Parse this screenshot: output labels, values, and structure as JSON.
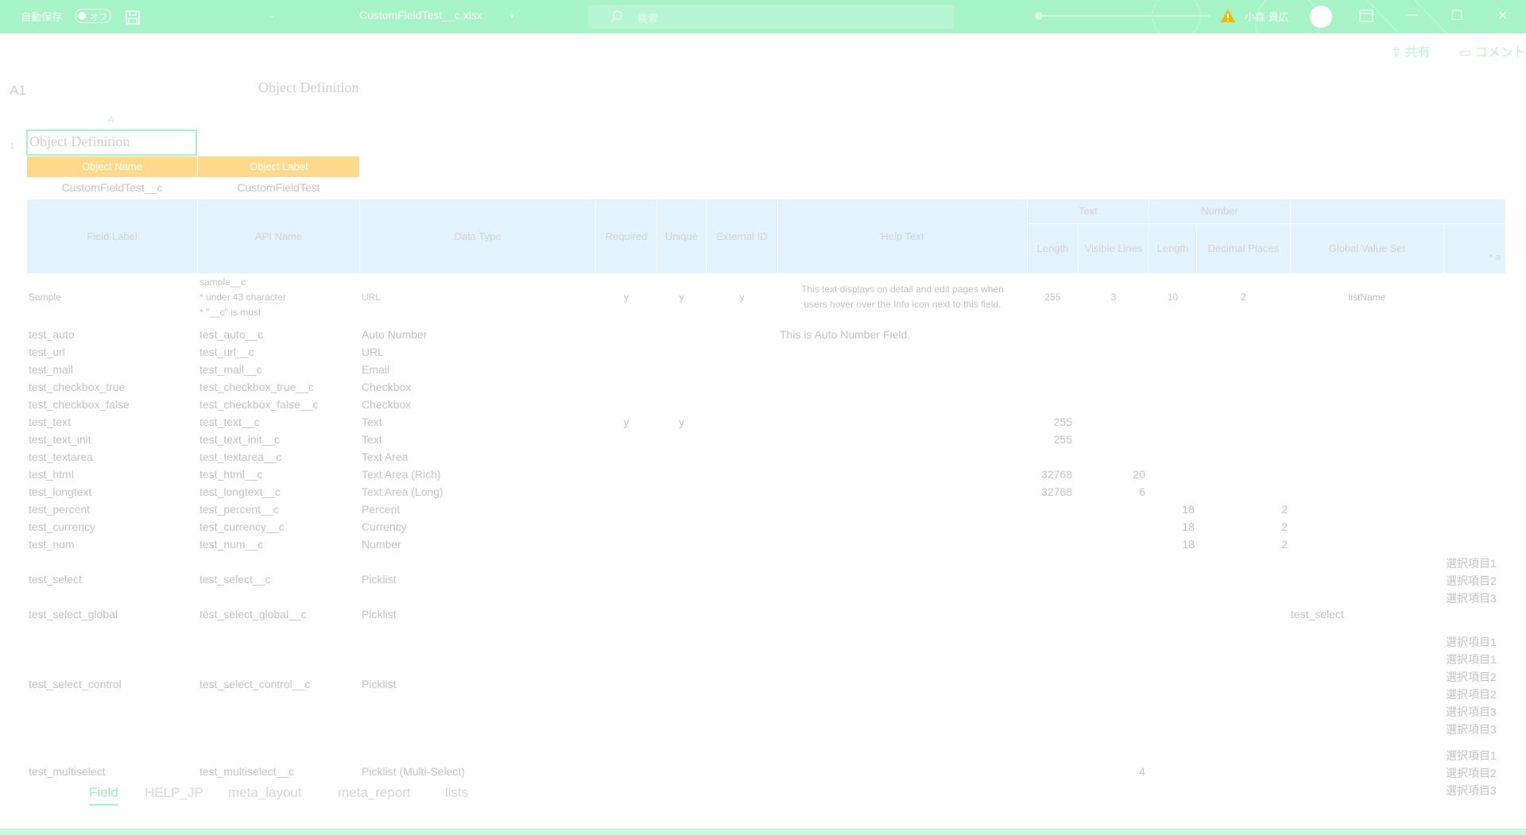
{
  "titlebar": {
    "autosave_label": "自動保存",
    "autosave_state": "オフ",
    "filename": "CustomFieldTest__c.xlsx",
    "search_placeholder": "検索",
    "user_name": "小森 貴広",
    "bg_color": "#a6f3c7"
  },
  "ribbon": {
    "share_label": "共有",
    "comment_label": "コメント"
  },
  "formula_bar": {
    "name_box": "A1",
    "formula": "Object Definition"
  },
  "sheet": {
    "column_letter": "A",
    "row_number": "1",
    "title": "Object Definition",
    "object_headers": [
      "Object Name",
      "Object Label"
    ],
    "object_values": [
      "CustomFieldTest__c",
      "CustomFieldTest"
    ],
    "headers": {
      "field_label": "Field Label",
      "api_name": "API Name",
      "data_type": "Data Type",
      "required": "Required",
      "unique": "Unique",
      "external_id": "External ID",
      "help_text": "Help Text",
      "text_group": "Text",
      "number_group": "Number",
      "text_length": "Length",
      "visible_lines": "Visible Lines",
      "num_length": "Length",
      "decimal_places": "Decimal Places",
      "global_value_set": "Global Value Set",
      "values_partial": "* a"
    },
    "sample": {
      "label": "Sample",
      "api_lines": [
        "sample__c",
        "* under 43 character",
        "* \"__c\" is must"
      ],
      "type": "URL",
      "required": "y",
      "unique": "y",
      "external_id": "y",
      "help_lines": [
        "This text displays on detail and edit pages when",
        "users hover over the Info icon next to this field."
      ],
      "text_length": "255",
      "visible_lines": "3",
      "num_length": "10",
      "decimal": "2",
      "global_value_set": "listName"
    },
    "rows": [
      {
        "label": "test_auto",
        "api": "test_auto__c",
        "type": "Auto Number",
        "required": "",
        "unique": "",
        "help": "This is Auto Number Field.",
        "tlen": "",
        "vlines": "",
        "nlen": "",
        "dec": "",
        "gvs": "",
        "values": []
      },
      {
        "label": "test_url",
        "api": "test_url__c",
        "type": "URL",
        "required": "",
        "unique": "",
        "help": "",
        "tlen": "",
        "vlines": "",
        "nlen": "",
        "dec": "",
        "gvs": "",
        "values": []
      },
      {
        "label": "test_mail",
        "api": "test_mail__c",
        "type": "Email",
        "required": "",
        "unique": "",
        "help": "",
        "tlen": "",
        "vlines": "",
        "nlen": "",
        "dec": "",
        "gvs": "",
        "values": []
      },
      {
        "label": "test_checkbox_true",
        "api": "test_checkbox_true__c",
        "type": "Checkbox",
        "required": "",
        "unique": "",
        "help": "",
        "tlen": "",
        "vlines": "",
        "nlen": "",
        "dec": "",
        "gvs": "",
        "values": []
      },
      {
        "label": "test_checkbox_false",
        "api": "test_checkbox_false__c",
        "type": "Checkbox",
        "required": "",
        "unique": "",
        "help": "",
        "tlen": "",
        "vlines": "",
        "nlen": "",
        "dec": "",
        "gvs": "",
        "values": []
      },
      {
        "label": "test_text",
        "api": "test_text__c",
        "type": "Text",
        "required": "y",
        "unique": "y",
        "help": "",
        "tlen": "255",
        "vlines": "",
        "nlen": "",
        "dec": "",
        "gvs": "",
        "values": []
      },
      {
        "label": "test_text_init",
        "api": "test_text_init__c",
        "type": "Text",
        "required": "",
        "unique": "",
        "help": "",
        "tlen": "255",
        "vlines": "",
        "nlen": "",
        "dec": "",
        "gvs": "",
        "values": []
      },
      {
        "label": "test_textarea",
        "api": "test_textarea__c",
        "type": "Text Area",
        "required": "",
        "unique": "",
        "help": "",
        "tlen": "",
        "vlines": "",
        "nlen": "",
        "dec": "",
        "gvs": "",
        "values": []
      },
      {
        "label": "test_html",
        "api": "test_html__c",
        "type": "Text Area (Rich)",
        "required": "",
        "unique": "",
        "help": "",
        "tlen": "32768",
        "vlines": "20",
        "nlen": "",
        "dec": "",
        "gvs": "",
        "values": []
      },
      {
        "label": "test_longtext",
        "api": "test_longtext__c",
        "type": "Text Area (Long)",
        "required": "",
        "unique": "",
        "help": "",
        "tlen": "32768",
        "vlines": "6",
        "nlen": "",
        "dec": "",
        "gvs": "",
        "values": []
      },
      {
        "label": "test_percent",
        "api": "test_percent__c",
        "type": "Percent",
        "required": "",
        "unique": "",
        "help": "",
        "tlen": "",
        "vlines": "",
        "nlen": "18",
        "dec": "2",
        "gvs": "",
        "values": []
      },
      {
        "label": "test_currency",
        "api": "test_currency__c",
        "type": "Currency",
        "required": "",
        "unique": "",
        "help": "",
        "tlen": "",
        "vlines": "",
        "nlen": "18",
        "dec": "2",
        "gvs": "",
        "values": []
      },
      {
        "label": "test_num",
        "api": "test_num__c",
        "type": "Number",
        "required": "",
        "unique": "",
        "help": "",
        "tlen": "",
        "vlines": "",
        "nlen": "18",
        "dec": "2",
        "gvs": "",
        "values": []
      },
      {
        "label": "test_select",
        "api": "test_select__c",
        "type": "Picklist",
        "required": "",
        "unique": "",
        "help": "",
        "tlen": "",
        "vlines": "",
        "nlen": "",
        "dec": "",
        "gvs": "",
        "values": [
          "選択項目1",
          "選択項目2",
          "選択項目3"
        ]
      },
      {
        "label": "test_select_global",
        "api": "test_select_global__c",
        "type": "Picklist",
        "required": "",
        "unique": "",
        "help": "",
        "tlen": "",
        "vlines": "",
        "nlen": "",
        "dec": "",
        "gvs": "test_select",
        "values": []
      },
      {
        "label": "test_select_control",
        "api": "test_select_control__c",
        "type": "Picklist",
        "required": "",
        "unique": "",
        "help": "",
        "tlen": "",
        "vlines": "",
        "nlen": "",
        "dec": "",
        "gvs": "",
        "values": [
          "選択項目1",
          "選択項目1",
          "選択項目2",
          "選択項目2",
          "選択項目3",
          "選択項目3"
        ]
      },
      {
        "label": "test_multiselect",
        "api": "test_multiselect__c",
        "type": "Picklist (Multi-Select)",
        "required": "",
        "unique": "",
        "help": "",
        "tlen": "",
        "vlines": "4",
        "nlen": "",
        "dec": "",
        "gvs": "",
        "values": [
          "選択項目1",
          "選択項目2",
          "選択項目3"
        ]
      }
    ]
  },
  "sheet_tabs": [
    "Field",
    "HELP_JP",
    "meta_layout",
    "meta_report",
    "lists"
  ]
}
